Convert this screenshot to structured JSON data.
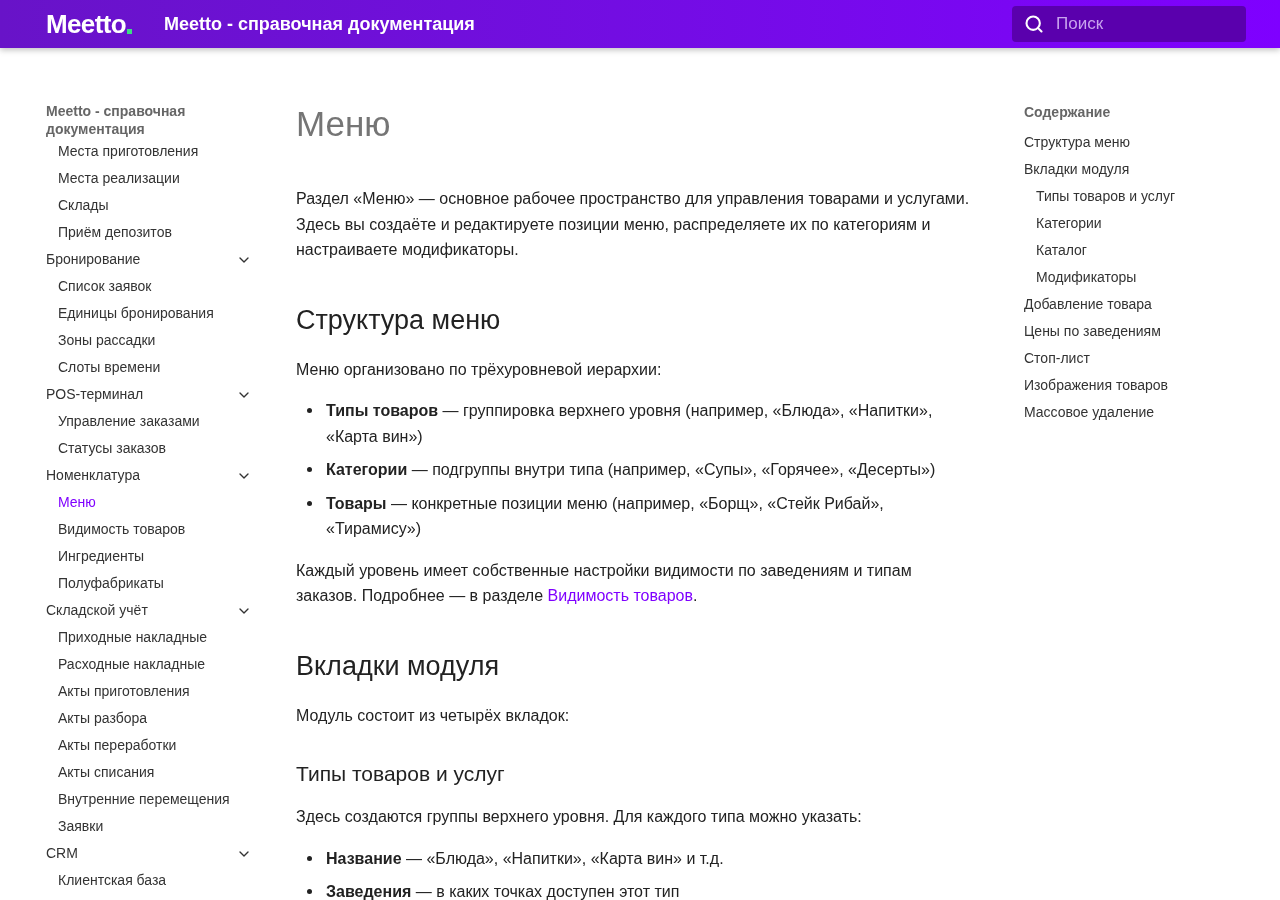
{
  "header": {
    "logo": "Meetto",
    "title": "Meetto - справочная документация",
    "search": {
      "placeholder": "Поиск"
    }
  },
  "nav": {
    "title": "Meetto - справочная документация",
    "orphan_items": [
      {
        "label": "Места приготовления",
        "selected": false
      },
      {
        "label": "Места реализации",
        "selected": false
      },
      {
        "label": "Склады",
        "selected": false
      },
      {
        "label": "Приём депозитов",
        "selected": false
      }
    ],
    "sections": [
      {
        "label": "Бронирование",
        "expanded": true,
        "children": [
          {
            "label": "Список заявок",
            "selected": false
          },
          {
            "label": "Единицы бронирования",
            "selected": false
          },
          {
            "label": "Зоны рассадки",
            "selected": false
          },
          {
            "label": "Слоты времени",
            "selected": false
          }
        ]
      },
      {
        "label": "POS-терминал",
        "expanded": true,
        "children": [
          {
            "label": "Управление заказами",
            "selected": false
          },
          {
            "label": "Статусы заказов",
            "selected": false
          }
        ]
      },
      {
        "label": "Номенклатура",
        "expanded": true,
        "children": [
          {
            "label": "Меню",
            "selected": true
          },
          {
            "label": "Видимость товаров",
            "selected": false
          },
          {
            "label": "Ингредиенты",
            "selected": false
          },
          {
            "label": "Полуфабрикаты",
            "selected": false
          }
        ]
      },
      {
        "label": "Складской учёт",
        "expanded": true,
        "children": [
          {
            "label": "Приходные накладные",
            "selected": false
          },
          {
            "label": "Расходные накладные",
            "selected": false
          },
          {
            "label": "Акты приготовления",
            "selected": false
          },
          {
            "label": "Акты разбора",
            "selected": false
          },
          {
            "label": "Акты переработки",
            "selected": false
          },
          {
            "label": "Акты списания",
            "selected": false
          },
          {
            "label": "Внутренние перемещения",
            "selected": false
          },
          {
            "label": "Заявки",
            "selected": false
          }
        ]
      },
      {
        "label": "CRM",
        "expanded": true,
        "children": [
          {
            "label": "Клиентская база",
            "selected": false
          }
        ]
      }
    ]
  },
  "content": [
    {
      "kind": "h1",
      "text": "Меню"
    },
    {
      "kind": "p",
      "text": "Раздел «Меню» — основное рабочее пространство для управления товарами и услугами. Здесь вы создаёте и редактируете позиции меню, распределяете их по категориям и настраиваете модификаторы."
    },
    {
      "kind": "h2",
      "text": "Структура меню"
    },
    {
      "kind": "p",
      "text": "Меню организовано по трёхуровневой иерархии:"
    },
    {
      "kind": "ul",
      "items": [
        "**Типы товаров** — группировка верхнего уровня (например, «Блюда», «Напитки», «Карта вин»)",
        "**Категории** — подгруппы внутри типа (например, «Супы», «Горячее», «Десерты»)",
        "**Товары** — конкретные позиции меню (например, «Борщ», «Стейк Рибай», «Тирамису»)"
      ]
    },
    {
      "kind": "p_link",
      "text": "Каждый уровень имеет собственные настройки видимости по заведениям и типам заказов. Подробнее — в разделе ",
      "link": "Видимость товаров",
      "after": "."
    },
    {
      "kind": "h2",
      "text": "Вкладки модуля"
    },
    {
      "kind": "p",
      "text": "Модуль состоит из четырёх вкладок:"
    },
    {
      "kind": "h3",
      "text": "Типы товаров и услуг"
    },
    {
      "kind": "p",
      "text": "Здесь создаются группы верхнего уровня. Для каждого типа можно указать:"
    },
    {
      "kind": "ul",
      "items": [
        "**Название** — «Блюда», «Напитки», «Карта вин» и т.д.",
        "**Заведения** — в каких точках доступен этот тип"
      ]
    }
  ],
  "toc": {
    "title": "Содержание",
    "items": [
      {
        "label": "Структура меню"
      },
      {
        "label": "Вкладки модуля",
        "children": [
          {
            "label": "Типы товаров и услуг"
          },
          {
            "label": "Категории"
          },
          {
            "label": "Каталог"
          },
          {
            "label": "Модификаторы"
          }
        ]
      },
      {
        "label": "Добавление товара"
      },
      {
        "label": "Цены по заведениям"
      },
      {
        "label": "Стоп-лист"
      },
      {
        "label": "Изображения товаров"
      },
      {
        "label": "Массовое удаление"
      }
    ]
  }
}
